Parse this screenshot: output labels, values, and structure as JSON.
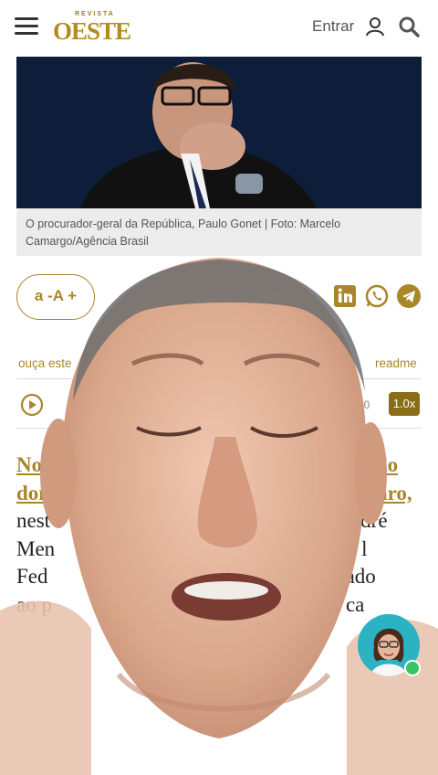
{
  "header": {
    "logo_small": "REVISTA",
    "logo_big": "OESTE",
    "login_label": "Entrar"
  },
  "hero": {
    "caption": "O procurador-geral da República, Paulo Gonet | Foto: Marcelo Camargo/Agência Brasil"
  },
  "tools": {
    "font_size_label": "a -A +",
    "listen_label": "ouça este",
    "readme_label": "readme",
    "time": "00",
    "speed": "1.0x",
    "share_icons": [
      "linkedin-icon",
      "whatsapp-icon",
      "telegram-icon"
    ]
  },
  "article": {
    "line1_link": "No",
    "line1_link_end": "são do",
    "line2_link": "don",
    "line2_link_end": "rcaro,",
    "line3_a": "nest",
    "line3_b": "André",
    "line4_a": "Men",
    "line4_b": "l",
    "line5_a": "Fed",
    "line5_b": "recado",
    "line6_a": "ao p",
    "line6_b": "ca"
  },
  "colors": {
    "accent": "#a8862a",
    "hero_bg": "#0b1a33",
    "chat_bg": "#2bb3c4",
    "online": "#36c465"
  }
}
